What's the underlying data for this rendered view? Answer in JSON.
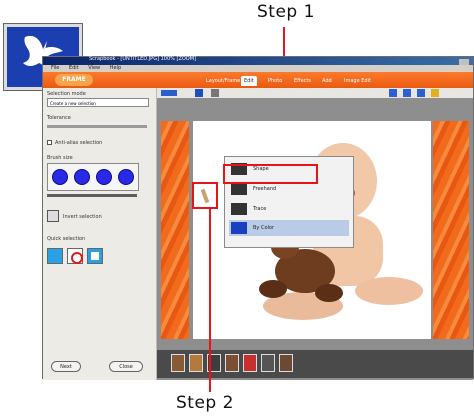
{
  "callouts": {
    "step1": "Step 1",
    "step2": "Step 2"
  },
  "app": {
    "title_text": "Scrapbook - [UNTITLED.JPG] 100% [ZOOM]",
    "menu": [
      "File",
      "Edit",
      "View",
      "Help"
    ],
    "logo_text": "FRAME",
    "tabs": [
      "Layout/Frame",
      "Edit",
      "Photo",
      "Effects",
      "Add",
      "Image Edit"
    ],
    "active_tab_index": 1,
    "left_panel": {
      "selection_mode_label": "Selection mode",
      "selection_mode_value": "Create a new selection",
      "tolerance_label": "Tolerance",
      "antialias_label": "Anti-alias selection",
      "brush_label": "Brush size",
      "brush_count": 4,
      "invert_label": "Invert selection",
      "quick_label": "Quick selection",
      "ok_label": "Next",
      "close_label": "Close"
    },
    "dropdown": {
      "items": [
        {
          "label": "Shape",
          "icon": "shape-icon"
        },
        {
          "label": "Freehand",
          "icon": "freehand-icon"
        },
        {
          "label": "Trace",
          "icon": "trace-icon"
        },
        {
          "label": "By Color",
          "icon": "magic-wand-icon"
        }
      ],
      "selected_index": 3
    },
    "colors": {
      "accent": "#e8141b",
      "orange": "#f26a1b",
      "title_bar": "#0a246a"
    }
  }
}
